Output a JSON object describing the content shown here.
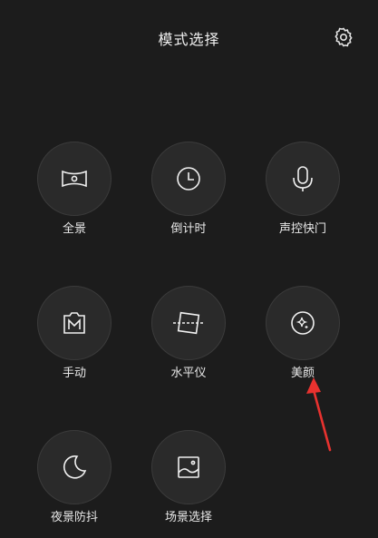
{
  "header": {
    "title": "模式选择",
    "settings_icon": "gear-icon"
  },
  "modes": [
    {
      "id": "panorama",
      "label": "全景",
      "icon": "panorama-icon"
    },
    {
      "id": "timer",
      "label": "倒计时",
      "icon": "clock-icon"
    },
    {
      "id": "voice-shutter",
      "label": "声控快门",
      "icon": "microphone-icon"
    },
    {
      "id": "manual",
      "label": "手动",
      "icon": "manual-m-icon"
    },
    {
      "id": "level",
      "label": "水平仪",
      "icon": "level-icon"
    },
    {
      "id": "beauty",
      "label": "美颜",
      "icon": "sparkle-icon"
    },
    {
      "id": "night",
      "label": "夜景防抖",
      "icon": "moon-icon"
    },
    {
      "id": "scene",
      "label": "场景选择",
      "icon": "scene-picture-icon"
    }
  ],
  "annotation": {
    "arrow_color": "#e8322f",
    "points_to": "美颜"
  }
}
